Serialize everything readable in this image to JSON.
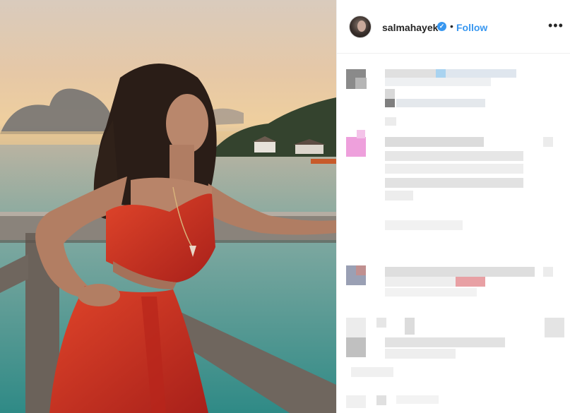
{
  "post": {
    "username": "salmahayek",
    "verified_mark": "✓",
    "separator": "•",
    "follow_label": "Follow",
    "more_label": "•••"
  },
  "icons": {
    "avatar": "profile-avatar",
    "verified": "verified-badge-icon",
    "more": "more-options-icon"
  },
  "colors": {
    "accent": "#3897f0",
    "text": "#262626",
    "border": "#efefef"
  },
  "comments_state": "pixelated"
}
